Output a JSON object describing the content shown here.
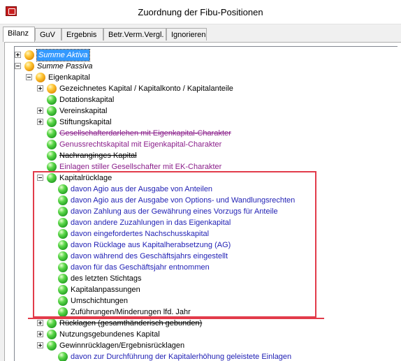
{
  "window": {
    "title": "Zuordnung der Fibu-Positionen"
  },
  "tabs": [
    {
      "label": "Bilanz",
      "active": true
    },
    {
      "label": "GuV"
    },
    {
      "label": "Ergebnis"
    },
    {
      "label": "Betr.Verm.Vergl."
    },
    {
      "label": "Ignorieren"
    }
  ],
  "tree": [
    {
      "label": "Summe Aktiva",
      "expander": "plus",
      "icon": "orange",
      "style": "selected-italic"
    },
    {
      "label": "Summe Passiva",
      "expander": "minus",
      "icon": "orange",
      "style": "italic"
    },
    {
      "label": "Eigenkapital",
      "expander": "minus",
      "icon": "orange",
      "style": "black"
    },
    {
      "label": "Gezeichnetes Kapital / Kapitalkonto / Kapitalanteile",
      "expander": "plus",
      "icon": "orange",
      "style": "black"
    },
    {
      "label": "Dotationskapital",
      "expander": "none",
      "icon": "green",
      "style": "black"
    },
    {
      "label": "Vereinskapital",
      "expander": "plus",
      "icon": "green",
      "style": "black"
    },
    {
      "label": "Stiftungskapital",
      "expander": "plus",
      "icon": "green",
      "style": "black"
    },
    {
      "label": "Gesellschafterdarlehen mit Eigenkapital-Charakter",
      "expander": "none",
      "icon": "green",
      "style": "purple-strike"
    },
    {
      "label": "Genussrechtskapital mit Eigenkapital-Charakter",
      "expander": "none",
      "icon": "green",
      "style": "purple"
    },
    {
      "label": "Nachranginges Kapital",
      "expander": "none",
      "icon": "green",
      "style": "black-strike"
    },
    {
      "label": "Einlagen stiller Gesellschafter mit EK-Charakter",
      "expander": "none",
      "icon": "green",
      "style": "purple"
    },
    {
      "label": "Kapitalrücklage",
      "expander": "minus",
      "icon": "green",
      "style": "black"
    },
    {
      "label": "davon Agio aus der Ausgabe von Anteilen",
      "expander": "none",
      "icon": "green",
      "style": "blue"
    },
    {
      "label": "davon Agio aus der Ausgabe von Options- und Wandlungsrechten",
      "expander": "none",
      "icon": "green",
      "style": "blue"
    },
    {
      "label": "davon Zahlung aus der Gewährung eines Vorzugs für Anteile",
      "expander": "none",
      "icon": "green",
      "style": "blue"
    },
    {
      "label": "davon andere Zuzahlungen in das Eigenkapital",
      "expander": "none",
      "icon": "green",
      "style": "blue"
    },
    {
      "label": "davon eingefordertes Nachschusskapital",
      "expander": "none",
      "icon": "green",
      "style": "blue"
    },
    {
      "label": "davon Rücklage aus Kapitalherabsetzung (AG)",
      "expander": "none",
      "icon": "green",
      "style": "blue"
    },
    {
      "label": "davon während des Geschäftsjahrs eingestellt",
      "expander": "none",
      "icon": "green",
      "style": "blue"
    },
    {
      "label": "davon für das Geschäftsjahr entnommen",
      "expander": "none",
      "icon": "green",
      "style": "blue"
    },
    {
      "label": "des letzten Stichtags",
      "expander": "none",
      "icon": "green",
      "style": "black"
    },
    {
      "label": "Kapitalanpassungen",
      "expander": "none",
      "icon": "green",
      "style": "black"
    },
    {
      "label": "Umschichtungen",
      "expander": "none",
      "icon": "green",
      "style": "black"
    },
    {
      "label": "Zuführungen/Minderungen lfd. Jahr",
      "expander": "none",
      "icon": "green",
      "style": "black"
    },
    {
      "label": "Rücklagen (gesamthänderisch gebunden)",
      "expander": "plus",
      "icon": "green",
      "style": "black-strike"
    },
    {
      "label": "Nutzungsgebundenes Kapital",
      "expander": "plus",
      "icon": "green",
      "style": "black"
    },
    {
      "label": "Gewinnrücklagen/Ergebnisrücklagen",
      "expander": "plus",
      "icon": "green",
      "style": "black"
    },
    {
      "label": "davon zur Durchführung der Kapitalerhöhung geleistete Einlagen",
      "expander": "none",
      "icon": "green",
      "style": "blue"
    }
  ]
}
